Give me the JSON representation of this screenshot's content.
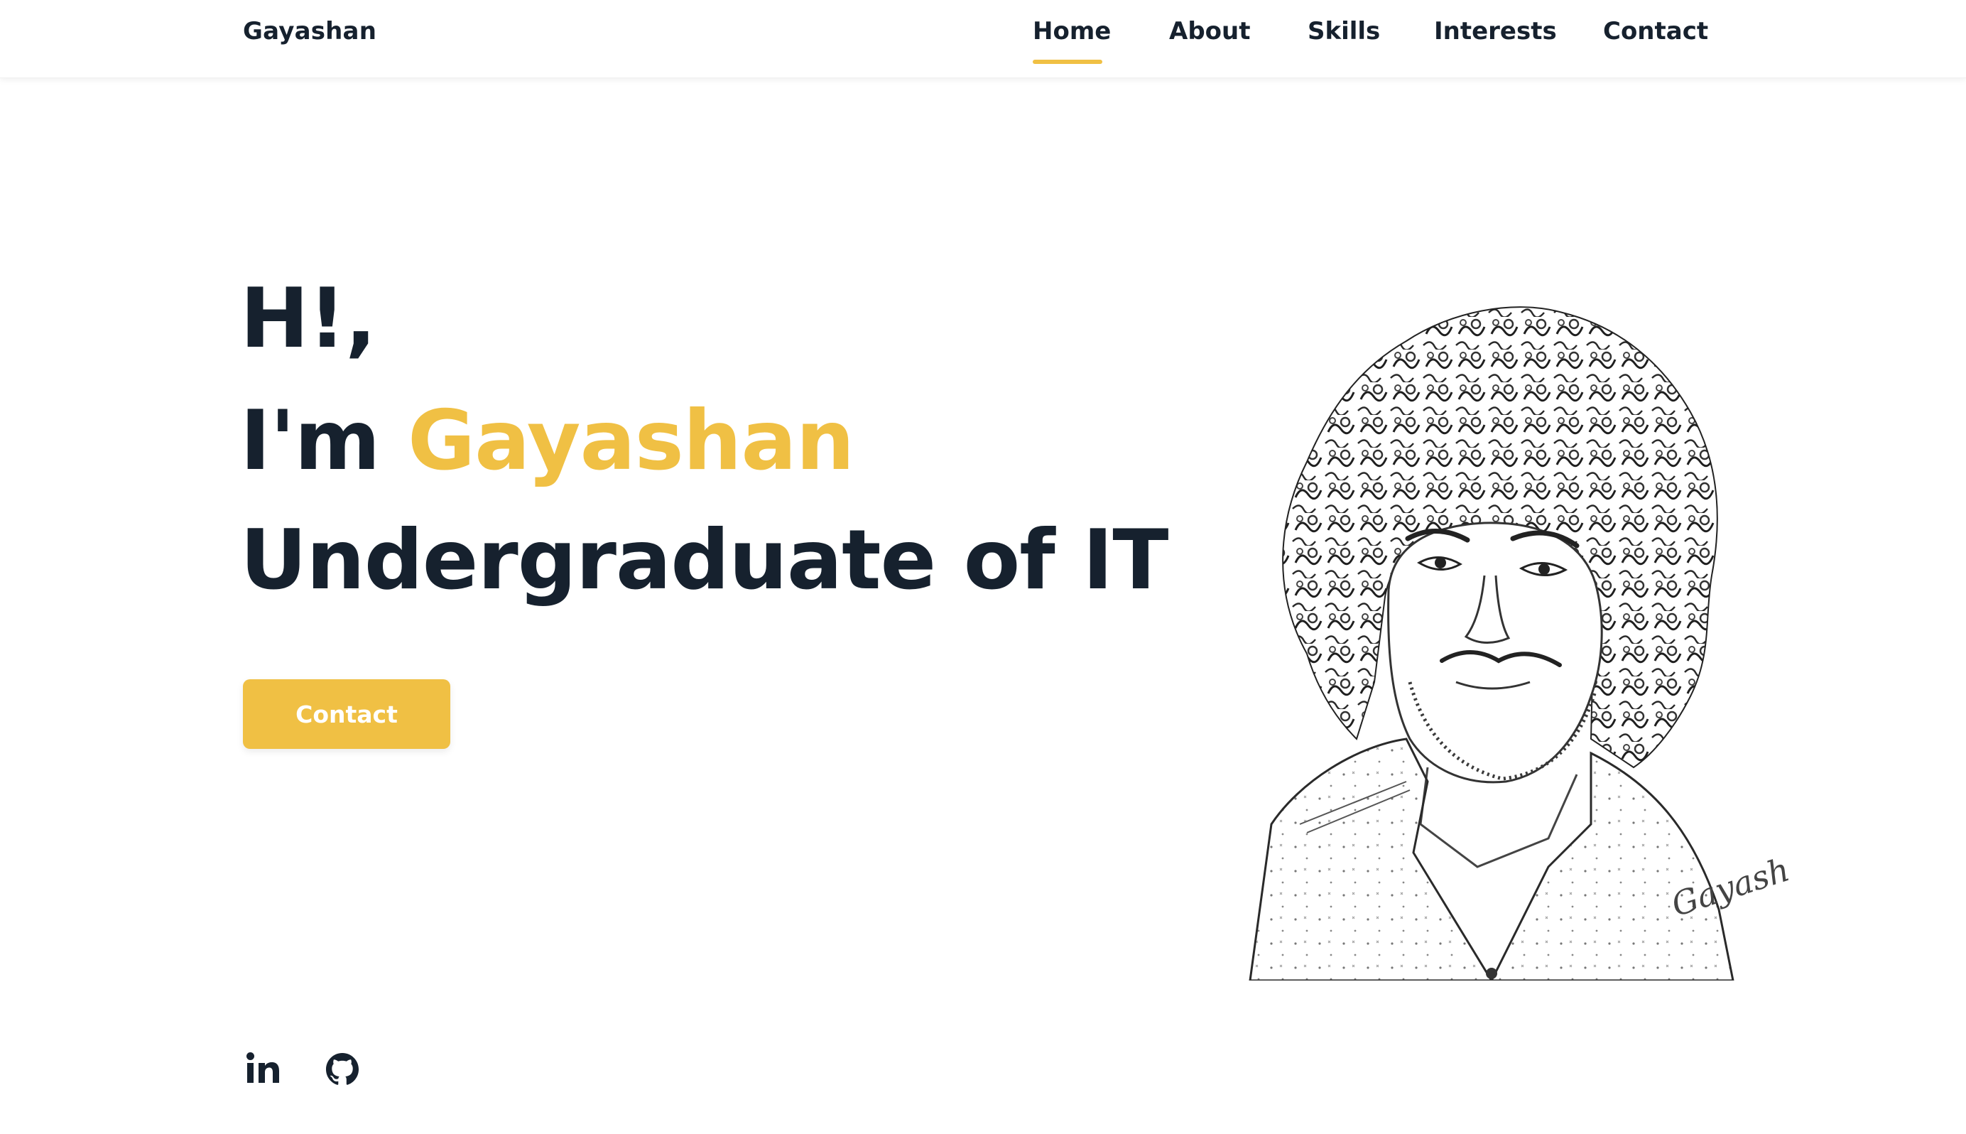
{
  "brand": {
    "name": "Gayashan",
    "accent_color": "#f0c044",
    "text_color": "#16212e"
  },
  "nav": {
    "items": [
      {
        "label": "Home",
        "active": true
      },
      {
        "label": "About",
        "active": false
      },
      {
        "label": "Skills",
        "active": false
      },
      {
        "label": "Interests",
        "active": false
      },
      {
        "label": "Contact",
        "active": false
      }
    ]
  },
  "hero": {
    "greeting": "H!,",
    "intro_prefix": "I'm ",
    "name": "Gayashan",
    "role": "Undergraduate of IT",
    "cta_label": "Contact"
  },
  "portrait": {
    "style": "pencil-sketch",
    "signature": "Gayashan"
  },
  "social": {
    "links": [
      {
        "icon": "linkedin-icon"
      },
      {
        "icon": "github-icon"
      }
    ]
  }
}
